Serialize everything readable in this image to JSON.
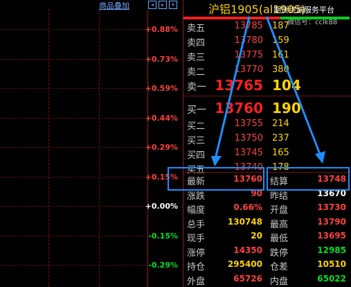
{
  "toolbar": {
    "overlay_label": "商品叠加",
    "btn1": "◂",
    "btn2": "▸",
    "btn3": "▾"
  },
  "chart": {
    "pct_labels": [
      {
        "v": "+0.88%",
        "c": "red"
      },
      {
        "v": "+0.73%",
        "c": "red"
      },
      {
        "v": "+0.59%",
        "c": "red"
      },
      {
        "v": "+0.44%",
        "c": "red"
      },
      {
        "v": "+0.29%",
        "c": "red"
      },
      {
        "v": "+0.15%",
        "c": "red"
      },
      {
        "v": "+0.00%",
        "c": "white"
      },
      {
        "v": "-0.15%",
        "c": "green"
      },
      {
        "v": "-0.29%",
        "c": "green"
      }
    ]
  },
  "quote": {
    "title": "沪铝1905(al1905)",
    "watermark": "期货终端服务平台",
    "watermark2": "微信号：cclk88",
    "asks": [
      {
        "label": "卖五",
        "price": "13785",
        "vol": "187"
      },
      {
        "label": "卖四",
        "price": "13780",
        "vol": "159"
      },
      {
        "label": "卖三",
        "price": "13775",
        "vol": "161"
      },
      {
        "label": "卖二",
        "price": "13770",
        "vol": "380"
      }
    ],
    "ask1": {
      "label": "卖一",
      "price": "13765",
      "vol": "104"
    },
    "bid1": {
      "label": "买一",
      "price": "13760",
      "vol": "190"
    },
    "bids": [
      {
        "label": "买二",
        "price": "13755",
        "vol": "214"
      },
      {
        "label": "买三",
        "price": "13750",
        "vol": "237"
      },
      {
        "label": "买四",
        "price": "13745",
        "vol": "165"
      },
      {
        "label": "买五",
        "price": "13740",
        "vol": "178"
      }
    ],
    "stats": [
      {
        "l1": "最新",
        "v1": "13760",
        "c1": "#ff4040",
        "l2": "结算",
        "v2": "13748",
        "c2": "#ff4040"
      },
      {
        "l1": "涨跌",
        "v1": "90",
        "c1": "#ff4040",
        "l2": "昨结",
        "v2": "13670",
        "c2": "#ffffff"
      },
      {
        "l1": "幅度",
        "v1": "0.66%",
        "c1": "#ff4040",
        "l2": "开盘",
        "v2": "13730",
        "c2": "#ff4040"
      },
      {
        "l1": "总手",
        "v1": "130748",
        "c1": "#ffd400",
        "l2": "最高",
        "v2": "13790",
        "c2": "#ff4040"
      },
      {
        "l1": "现手",
        "v1": "20",
        "c1": "#ffd400",
        "l2": "最低",
        "v2": "13695",
        "c2": "#ff4040"
      },
      {
        "l1": "涨停",
        "v1": "14350",
        "c1": "#ff4040",
        "l2": "跌停",
        "v2": "12985",
        "c2": "#00e020"
      },
      {
        "l1": "持仓",
        "v1": "295400",
        "c1": "#ffd400",
        "l2": "仓差",
        "v2": "10510",
        "c2": "#ffd400"
      },
      {
        "l1": "外盘",
        "v1": "65726",
        "c1": "#ff4040",
        "l2": "内盘",
        "v2": "65022",
        "c2": "#00e020"
      }
    ]
  }
}
